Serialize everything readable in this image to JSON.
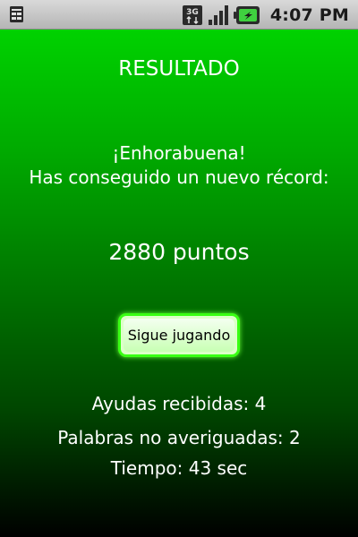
{
  "status_bar": {
    "time": "4:07 PM",
    "network_label": "3G",
    "icons": [
      "notification-icon",
      "network-3g-icon",
      "signal-icon",
      "battery-icon"
    ]
  },
  "result": {
    "title": "RESULTADO",
    "congrats": "¡Enhorabuena!",
    "record_message": "Has conseguido un nuevo récord:",
    "score": "2880 puntos",
    "continue_button_label": "Sigue jugando"
  },
  "stats": {
    "helps": "Ayudas recibidas: 4",
    "unguessed_words": "Palabras no averiguadas: 2",
    "time": "Tiempo: 43 sec"
  },
  "colors": {
    "background_top": "#00d200",
    "background_bottom": "#000000",
    "button_border": "#39ff14",
    "text": "#ffffff"
  }
}
